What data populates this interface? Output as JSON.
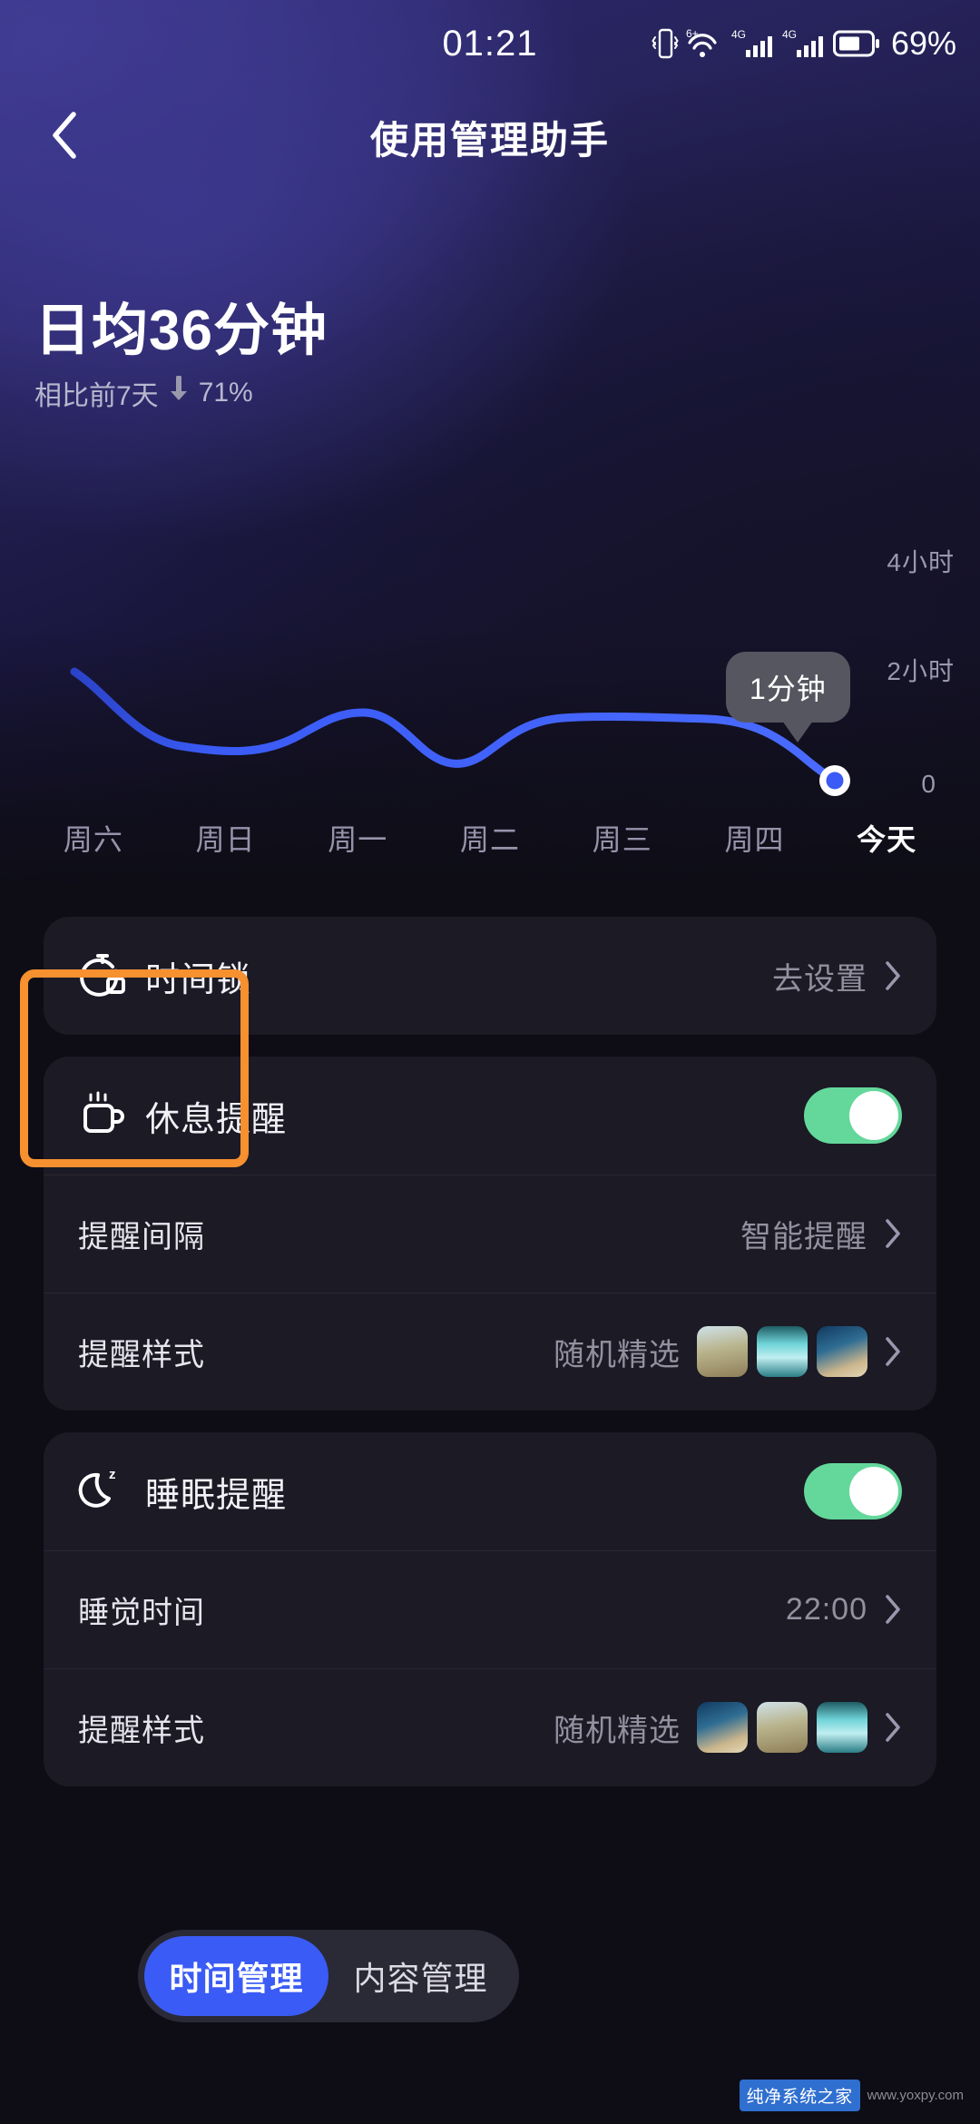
{
  "status_bar": {
    "time": "01:21",
    "battery_percent": "69%",
    "icons": [
      "vibrate-icon",
      "wifi-6-plus-icon",
      "signal-4g-icon",
      "signal-4g-icon",
      "battery-icon"
    ]
  },
  "nav": {
    "back_icon": "chevron-left-icon",
    "title": "使用管理助手"
  },
  "summary": {
    "headline": "日均36分钟",
    "compare_label": "相比前7天",
    "trend_arrow": "↓",
    "trend_value": "71%"
  },
  "chart_data": {
    "type": "line",
    "title": "",
    "categories": [
      "周六",
      "周日",
      "周一",
      "周二",
      "周三",
      "周四",
      "今天"
    ],
    "values": [
      2.2,
      1.1,
      1.45,
      0.85,
      1.6,
      1.6,
      0.02
    ],
    "value_unit": "小时",
    "ylim": [
      0,
      4
    ],
    "yticks": [
      0,
      2,
      4
    ],
    "ytick_labels": [
      "0",
      "2小时",
      "4小时"
    ],
    "xlabel": "",
    "ylabel": "",
    "grid": false,
    "legend": "none",
    "line_color": "#3a5bf5",
    "highlighted_point": {
      "category": "今天",
      "label": "1分钟",
      "value": 0.02
    }
  },
  "days": [
    {
      "label": "周六",
      "active": false
    },
    {
      "label": "周日",
      "active": false
    },
    {
      "label": "周一",
      "active": false
    },
    {
      "label": "周二",
      "active": false
    },
    {
      "label": "周三",
      "active": false
    },
    {
      "label": "周四",
      "active": false
    },
    {
      "label": "今天",
      "active": true
    }
  ],
  "cards": {
    "time_lock": {
      "icon": "timer-lock-icon",
      "label": "时间锁",
      "action_label": "去设置",
      "chevron": "chevron-right-icon"
    },
    "rest_reminder": {
      "icon": "coffee-cup-icon",
      "label": "休息提醒",
      "toggle_on": true,
      "rows": [
        {
          "label": "提醒间隔",
          "value": "智能提醒",
          "thumbs": false
        },
        {
          "label": "提醒样式",
          "value": "随机精选",
          "thumbs": true
        }
      ]
    },
    "sleep_reminder": {
      "icon": "moon-z-icon",
      "label": "睡眠提醒",
      "toggle_on": true,
      "rows": [
        {
          "label": "睡觉时间",
          "value": "22:00",
          "thumbs": false
        },
        {
          "label": "提醒样式",
          "value": "随机精选",
          "thumbs": true
        }
      ]
    }
  },
  "tabs": [
    {
      "label": "时间管理",
      "active": true
    },
    {
      "label": "内容管理",
      "active": false
    }
  ],
  "watermark": {
    "badge": "纯净系统之家",
    "text": "www.yoxpy.com"
  },
  "colors": {
    "accent_blue": "#3a5bf5",
    "toggle_green": "#64d89b",
    "highlight_orange": "#f7902f"
  }
}
